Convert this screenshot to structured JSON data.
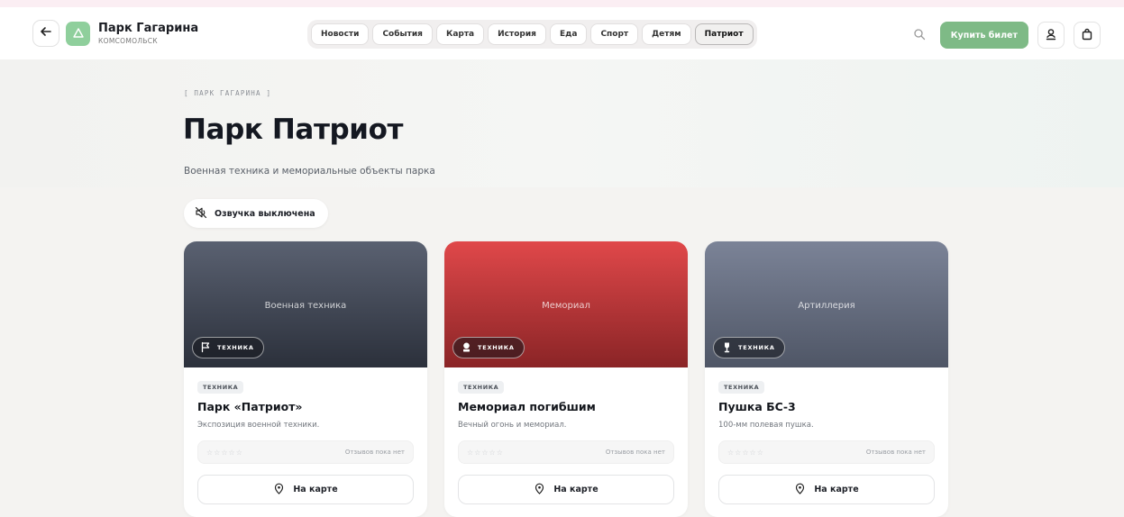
{
  "header": {
    "back_icon": "arrow-left-icon",
    "logo_icon": "park-logo-icon",
    "title": "Парк Гагарина",
    "subtitle": "КОМСОМОЛЬСК",
    "nav_tabs": [
      {
        "label": "Новости",
        "active": false
      },
      {
        "label": "События",
        "active": false
      },
      {
        "label": "Карта",
        "active": false
      },
      {
        "label": "История",
        "active": false
      },
      {
        "label": "Еда",
        "active": false
      },
      {
        "label": "Спорт",
        "active": false
      },
      {
        "label": "Детям",
        "active": false
      },
      {
        "label": "Патриот",
        "active": true
      }
    ],
    "buy_ticket_label": "Купить билет",
    "accent_color": "#7eba86"
  },
  "page": {
    "breadcrumb": "[ ПАРК ГАГАРИНА ]",
    "title": "Парк Патриот",
    "subtitle": "Военная техника и мемориальные объекты парка",
    "voice_label": "Озвучка выключена"
  },
  "cards": [
    {
      "image_caption": "Военная техника",
      "badge": "ТЕХНИКА",
      "badge_icon": "flag-icon",
      "tag": "ТЕХНИКА",
      "title": "Парк «Патриот»",
      "description": "Экспозиция военной техники.",
      "stars": "☆☆☆☆☆",
      "reviews_text": "Отзывов пока нет",
      "map_label": "На карте",
      "gradient": [
        "#5a6171",
        "#2b303b"
      ]
    },
    {
      "image_caption": "Мемориал",
      "badge": "ТЕХНИКА",
      "badge_icon": "memorial-icon",
      "tag": "ТЕХНИКА",
      "title": "Мемориал погибшим",
      "description": "Вечный огонь и мемориал.",
      "stars": "☆☆☆☆☆",
      "reviews_text": "Отзывов пока нет",
      "map_label": "На карте",
      "gradient": [
        "#e0484a",
        "#8a2426"
      ]
    },
    {
      "image_caption": "Артиллерия",
      "badge": "ТЕХНИКА",
      "badge_icon": "trophy-icon",
      "tag": "ТЕХНИКА",
      "title": "Пушка БС-3",
      "description": "100-мм полевая пушка.",
      "stars": "☆☆☆☆☆",
      "reviews_text": "Отзывов пока нет",
      "map_label": "На карте",
      "gradient": [
        "#7b8397",
        "#4f5666"
      ]
    }
  ]
}
